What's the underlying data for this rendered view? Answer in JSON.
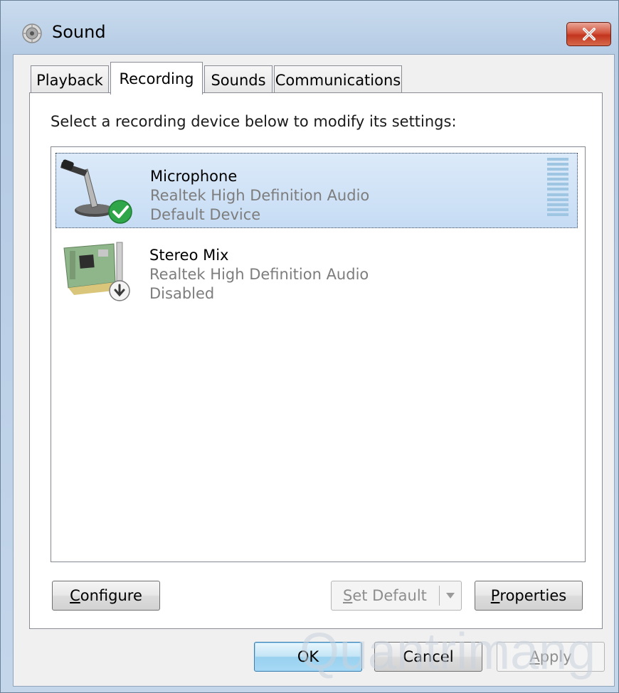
{
  "window": {
    "title": "Sound",
    "close_label": "✕"
  },
  "tabs": [
    {
      "label": "Playback",
      "active": false
    },
    {
      "label": "Recording",
      "active": true
    },
    {
      "label": "Sounds",
      "active": false
    },
    {
      "label": "Communications",
      "active": false
    }
  ],
  "recording": {
    "instruction": "Select a recording device below to modify its settings:",
    "devices": [
      {
        "name": "Microphone",
        "driver": "Realtek High Definition Audio",
        "status": "Default Device",
        "icon": "microphone-icon",
        "badge": "check-icon",
        "selected": true
      },
      {
        "name": "Stereo Mix",
        "driver": "Realtek High Definition Audio",
        "status": "Disabled",
        "icon": "sound-card-icon",
        "badge": "down-arrow-icon",
        "selected": false
      }
    ]
  },
  "buttons": {
    "configure_prefix": "C",
    "configure_rest": "onfigure",
    "set_default_prefix": "S",
    "set_default_rest": "et Default",
    "properties_prefix": "P",
    "properties_rest": "roperties",
    "ok": "OK",
    "cancel": "Cancel",
    "apply_prefix": "A",
    "apply_rest": "pply"
  },
  "watermark": "Quantrimang",
  "colors": {
    "selection_bg": "#c6dcf4",
    "close_button": "#c2341d",
    "secondary_text": "#7d7d7d"
  }
}
